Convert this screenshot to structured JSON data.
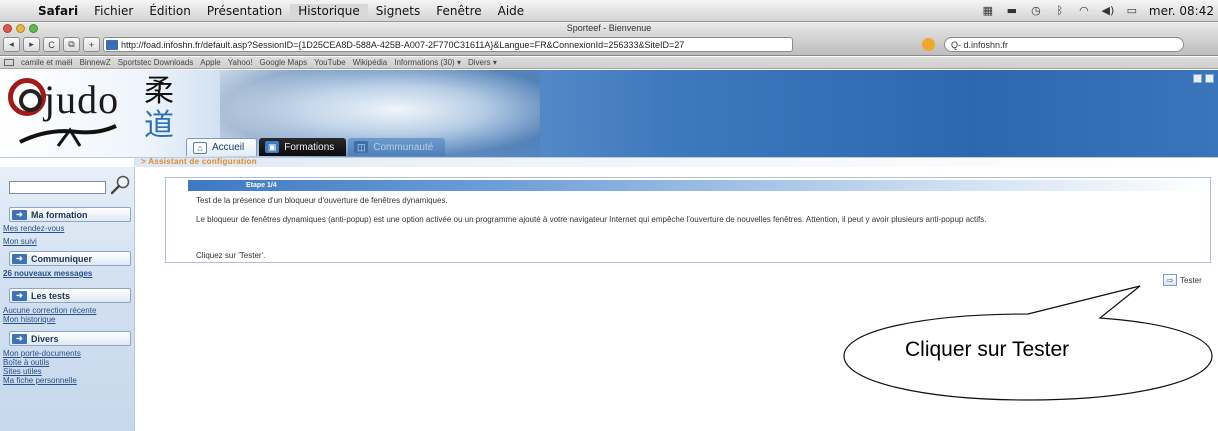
{
  "menubar": {
    "app": "Safari",
    "items": [
      "Fichier",
      "Édition",
      "Présentation",
      "Historique",
      "Signets",
      "Fenêtre",
      "Aide"
    ],
    "active_item": "Historique",
    "clock": "mer. 08:42",
    "status_icons": [
      "display-icon",
      "monitor-icon",
      "time-machine-icon",
      "bluetooth-icon",
      "wifi-icon",
      "volume-icon",
      "battery-icon"
    ]
  },
  "browser": {
    "window_title": "Sporteef - Bienvenue",
    "url": "http://foad.infoshn.fr/default.asp?SessionID={1D25CEA8D-588A-425B-A007-2F770C31611A}&Langue=FR&ConnexionId=256333&SiteID=27",
    "search_value": "Q- d.infoshn.fr",
    "toolbar_buttons": [
      "◂",
      "▸",
      "C",
      "⧉",
      "+"
    ],
    "bookmarks": [
      "camile et maël",
      "BinnewZ",
      "Sportstec Downloads",
      "Apple",
      "Yahoo!",
      "Google Maps",
      "YouTube",
      "Wikipédia",
      "Informations (30) ▾",
      "Divers ▾"
    ]
  },
  "site": {
    "logo_text": "judo",
    "logo_kanji_top": "柔",
    "logo_kanji_bottom": "道",
    "nav_tabs": [
      {
        "label": "Accueil",
        "icon": "home-icon",
        "glyph": "⌂"
      },
      {
        "label": "Formations",
        "icon": "formations-icon",
        "glyph": "▣"
      },
      {
        "label": "Communauté",
        "icon": "community-icon",
        "glyph": "◫"
      }
    ],
    "breadcrumb": "> Assistant de configuration"
  },
  "sidebar": {
    "search_placeholder": "",
    "sections": [
      {
        "title": "Ma formation",
        "links": [
          "Mes rendez-vous",
          "Mon suivi"
        ]
      },
      {
        "title": "Communiquer",
        "links": [
          "26 nouveaux messages"
        ]
      },
      {
        "title": "Les tests",
        "links": [
          "Aucune correction récente",
          "Mon historique"
        ]
      },
      {
        "title": "Divers",
        "links": [
          "Mon porte-documents",
          "Boîte à outils",
          "Sites utiles",
          "Ma fiche personnelle"
        ]
      }
    ]
  },
  "main": {
    "step_title": "Etape 1/4",
    "line1": "Test de la présence d'un bloqueur d'ouverture de fenêtres dynamiques.",
    "line2": "Le bloqueur de fenêtres dynamiques (anti-popup) est une option activée ou un programme ajouté à votre navigateur Internet qui empêche l'ouverture de nouvelles fenêtres. Attention, il peut y avoir plusieurs anti-popup actifs.",
    "line3": "Cliquez sur 'Tester'.",
    "tester_label": "Tester"
  },
  "annotation": {
    "callout_text": "Cliquer sur Tester"
  }
}
